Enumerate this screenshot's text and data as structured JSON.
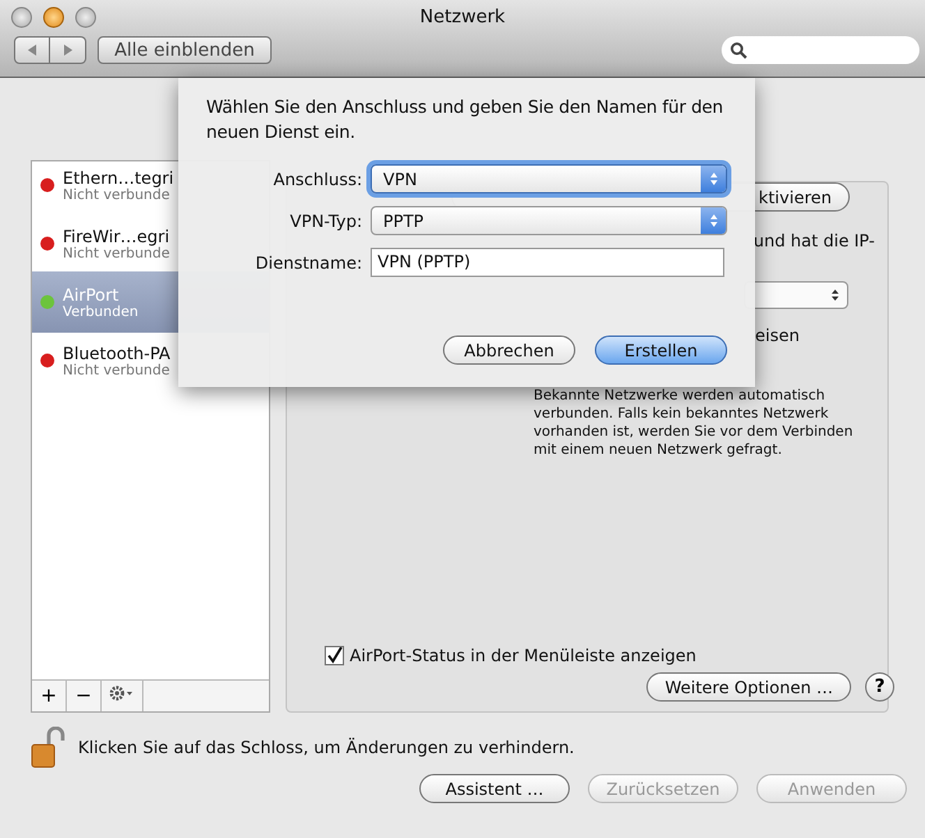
{
  "window": {
    "title": "Netzwerk"
  },
  "toolbar": {
    "show_all": "Alle einblenden"
  },
  "services": [
    {
      "name": "Ethern…tegri",
      "status": "Nicht verbunde",
      "selected": false,
      "color": "#d81e1e"
    },
    {
      "name": "FireWir…egri",
      "status": "Nicht verbunde",
      "selected": false,
      "color": "#d81e1e"
    },
    {
      "name": "AirPort",
      "status": "Verbunden",
      "selected": true,
      "color": "#6cc43c"
    },
    {
      "name": "Bluetooth-PA",
      "status": "Nicht verbunde",
      "selected": false,
      "color": "#d81e1e"
    }
  ],
  "list_toolbar": {
    "add": "+",
    "remove": "−"
  },
  "panel": {
    "partial_button": "ktivieren",
    "partial_text": "und hat die IP-",
    "partial_label": "eisen",
    "info": "Bekannte Netzwerke werden automatisch verbunden. Falls kein bekanntes Netzwerk vorhanden ist, werden Sie vor dem Verbinden mit einem neuen Netzwerk gefragt.",
    "checkbox": {
      "label": "AirPort-Status in der Menüleiste anzeigen",
      "checked": true
    },
    "more_button": "Weitere Optionen …",
    "help": "?"
  },
  "dialog": {
    "message": "Wählen Sie den Anschluss und geben Sie den Namen für den neuen Dienst ein.",
    "fields": [
      {
        "kind": "popup",
        "label": "Anschluss:",
        "value": "VPN",
        "focused": true
      },
      {
        "kind": "popup",
        "label": "VPN-Typ:",
        "value": "PPTP",
        "focused": false
      },
      {
        "kind": "text",
        "label": "Dienstname:",
        "value": "VPN (PPTP)",
        "focused": false
      }
    ],
    "buttons": [
      {
        "label": "Abbrechen",
        "default": false
      },
      {
        "label": "Erstellen",
        "default": true
      }
    ]
  },
  "footer": {
    "lock_message": "Klicken Sie auf das Schloss, um Änderungen zu verhindern.",
    "buttons": [
      {
        "label": "Assistent …",
        "disabled": false
      },
      {
        "label": "Zurücksetzen",
        "disabled": true
      },
      {
        "label": "Anwenden",
        "disabled": true
      }
    ]
  }
}
